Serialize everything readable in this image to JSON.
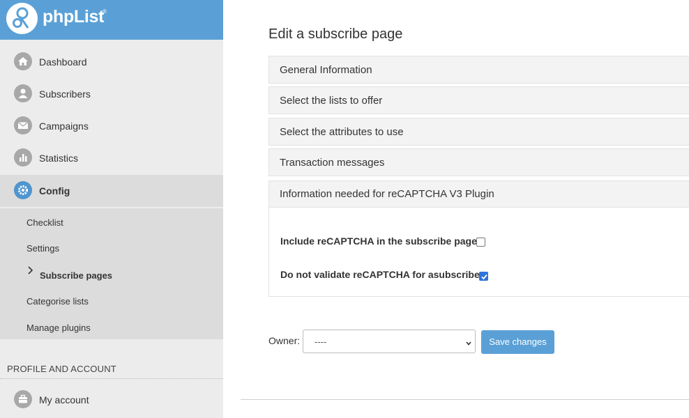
{
  "brand": {
    "name": "phpList",
    "reg": "®"
  },
  "nav": [
    {
      "label": "Dashboard",
      "icon": "home-icon"
    },
    {
      "label": "Subscribers",
      "icon": "user-icon"
    },
    {
      "label": "Campaigns",
      "icon": "envelope-icon"
    },
    {
      "label": "Statistics",
      "icon": "bar-chart-icon"
    },
    {
      "label": "Config",
      "icon": "gear-icon"
    }
  ],
  "config_submenu": [
    "Checklist",
    "Settings",
    "Subscribe pages",
    "Categorise lists",
    "Manage plugins"
  ],
  "profile_section": {
    "title": "PROFILE AND ACCOUNT",
    "items": [
      {
        "label": "My account",
        "icon": "briefcase-icon"
      }
    ]
  },
  "main": {
    "title": "Edit a subscribe page",
    "panels": [
      "General Information",
      "Select the lists to offer",
      "Select the attributes to use",
      "Transaction messages"
    ],
    "open_panel": {
      "title": "Information needed for reCAPTCHA V3 Plugin",
      "options": [
        {
          "label": "Include reCAPTCHA in the subscribe page",
          "checked": false
        },
        {
          "label": "Do not validate reCAPTCHA for asubscribe",
          "checked": true
        }
      ]
    },
    "owner": {
      "label": "Owner:",
      "value": "----"
    },
    "save_label": "Save changes"
  },
  "colors": {
    "brand_blue": "#5aa0d6",
    "checkbox_blue": "#2f73d9",
    "sidebar_bg": "#ececec"
  }
}
